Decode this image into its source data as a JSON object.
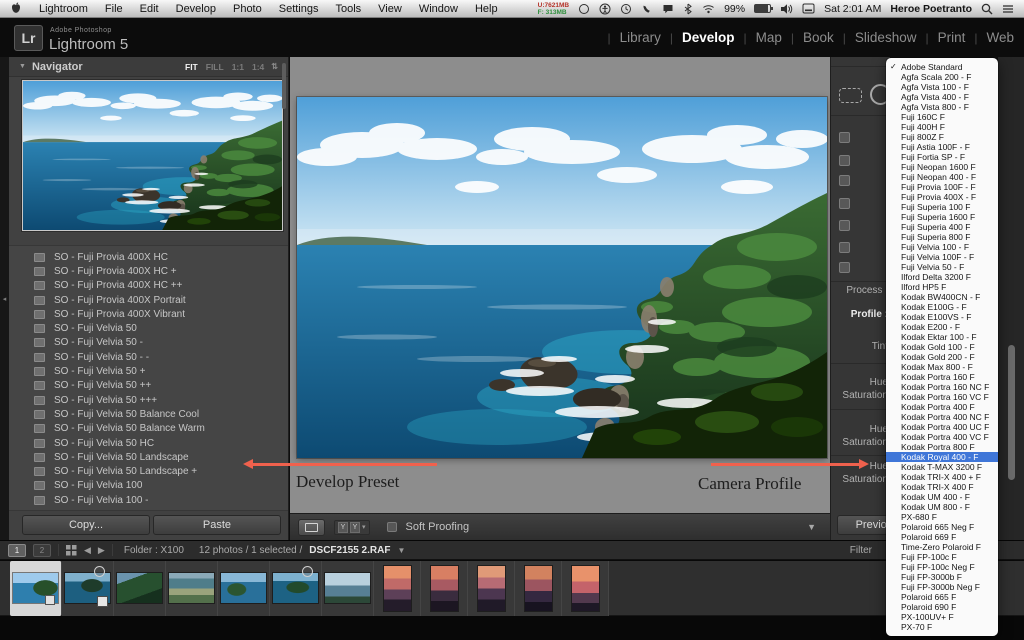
{
  "menubar": {
    "items": [
      "Lightroom",
      "File",
      "Edit",
      "Develop",
      "Photo",
      "Settings",
      "Tools",
      "View",
      "Window",
      "Help"
    ],
    "status": {
      "mem_used": "U:7621MB",
      "mem_free": "F: 313MB",
      "battery_pct": "99%",
      "clock": "Sat 2:01 AM",
      "user": "Heroe Poetranto"
    }
  },
  "titlebar": {
    "logo": "Lr",
    "app_small": "Adobe Photoshop",
    "app_name": "Lightroom 5",
    "modules": [
      {
        "label": "Library"
      },
      {
        "label": "Develop",
        "cls": "active"
      },
      {
        "label": "Map"
      },
      {
        "label": "Book"
      },
      {
        "label": "Slideshow"
      },
      {
        "label": "Print"
      },
      {
        "label": "Web"
      }
    ]
  },
  "navigator": {
    "collapse_glyph": "▼",
    "title": "Navigator",
    "zoom_options": [
      {
        "label": "FIT",
        "cls": "on"
      },
      {
        "label": "FILL"
      },
      {
        "label": "1:1"
      },
      {
        "label": "1:4"
      }
    ],
    "updown_glyph": "⇅"
  },
  "presets": {
    "items": [
      "SO - Fuji Provia 400X HC",
      "SO - Fuji Provia 400X HC +",
      "SO - Fuji Provia 400X HC ++",
      "SO - Fuji Provia 400X Portrait",
      "SO - Fuji Provia 400X Vibrant",
      "SO - Fuji Velvia 50",
      "SO - Fuji Velvia 50 -",
      "SO - Fuji Velvia 50 - -",
      "SO - Fuji Velvia 50 +",
      "SO - Fuji Velvia 50 ++",
      "SO - Fuji Velvia 50 +++",
      "SO - Fuji Velvia 50 Balance Cool",
      "SO - Fuji Velvia 50 Balance Warm",
      "SO - Fuji Velvia 50 HC",
      "SO - Fuji Velvia 50 Landscape",
      "SO - Fuji Velvia 50 Landscape +",
      "SO - Fuji Velvia 100",
      "SO - Fuji Velvia 100 -"
    ]
  },
  "left_buttons": {
    "copy": "Copy...",
    "paste": "Paste"
  },
  "toolbar": {
    "y_label": "Y",
    "soft_proofing": "Soft Proofing",
    "caret": "▼"
  },
  "annotations": {
    "develop_preset": "Develop Preset",
    "camera_profile": "Camera Profile",
    "arrow_color": "#f0614d"
  },
  "right_panel": {
    "process": "Process :",
    "profile": "Profile :",
    "tint": "Tint",
    "hue": "Hue",
    "saturation": "Saturation",
    "previous": "Previous"
  },
  "filmstrip": {
    "win1": "1",
    "win2": "2",
    "back_glyph": "◀",
    "fwd_glyph": "▶",
    "folder": "Folder : X100",
    "status": "12 photos / 1 selected /",
    "filename": "DSCF2155 2.RAF",
    "caret": "▼",
    "filter": "Filter",
    "thumbs": [
      {
        "cls": "wide v1 sel has-adj"
      },
      {
        "cls": "wide v2 has-circle has-crop"
      },
      {
        "cls": "wide v3"
      },
      {
        "cls": "wide v4"
      },
      {
        "cls": "wide v5"
      },
      {
        "cls": "wide v6 has-circle"
      },
      {
        "cls": "wide v7"
      },
      {
        "cls": "tall v8"
      },
      {
        "cls": "tall v9"
      },
      {
        "cls": "tall v10"
      },
      {
        "cls": "tall v11"
      },
      {
        "cls": "tall v12"
      }
    ]
  },
  "profile_menu": {
    "highlight_color": "#3f76d8",
    "items": [
      {
        "check": "✓",
        "label": "Adobe Standard"
      },
      {
        "label": "Agfa Scala 200 - F"
      },
      {
        "label": "Agfa Vista 100 - F"
      },
      {
        "label": "Agfa Vista 400 - F"
      },
      {
        "label": "Agfa Vista 800 - F"
      },
      {
        "label": "Fuji 160C F"
      },
      {
        "label": "Fuji 400H F"
      },
      {
        "label": "Fuji 800Z F"
      },
      {
        "label": "Fuji Astia 100F - F"
      },
      {
        "label": "Fuji Fortia SP - F"
      },
      {
        "label": "Fuji Neopan 1600 F"
      },
      {
        "label": "Fuji Neopan 400 - F"
      },
      {
        "label": "Fuji Provia 100F - F"
      },
      {
        "label": "Fuji Provia 400X - F"
      },
      {
        "label": "Fuji Superia 100 F"
      },
      {
        "label": "Fuji Superia 1600 F"
      },
      {
        "label": "Fuji Superia 400 F"
      },
      {
        "label": "Fuji Superia 800 F"
      },
      {
        "label": "Fuji Velvia 100 - F"
      },
      {
        "label": "Fuji Velvia 100F - F"
      },
      {
        "label": "Fuji Velvia 50 - F"
      },
      {
        "label": "Ilford Delta 3200 F"
      },
      {
        "label": "Ilford HP5 F"
      },
      {
        "label": "Kodak BW400CN - F"
      },
      {
        "label": "Kodak E100G - F"
      },
      {
        "label": "Kodak E100VS - F"
      },
      {
        "label": "Kodak E200 - F"
      },
      {
        "label": "Kodak Ektar 100 - F"
      },
      {
        "label": "Kodak Gold 100 - F"
      },
      {
        "label": "Kodak Gold 200 - F"
      },
      {
        "label": "Kodak Max 800 - F"
      },
      {
        "label": "Kodak Portra 160 F"
      },
      {
        "label": "Kodak Portra 160 NC F"
      },
      {
        "label": "Kodak Portra 160 VC F"
      },
      {
        "label": "Kodak Portra 400 F"
      },
      {
        "label": "Kodak Portra 400 NC F"
      },
      {
        "label": "Kodak Portra 400 UC F"
      },
      {
        "label": "Kodak Portra 400 VC F"
      },
      {
        "label": "Kodak Portra 800 F"
      },
      {
        "cls": "selected",
        "label": "Kodak Royal 400 - F"
      },
      {
        "label": "Kodak T-MAX 3200 F"
      },
      {
        "label": "Kodak TRI-X 400 + F"
      },
      {
        "label": "Kodak TRI-X 400 F"
      },
      {
        "label": "Kodak UM 400 - F"
      },
      {
        "label": "Kodak UM 800 - F"
      },
      {
        "label": "PX-680 F"
      },
      {
        "label": "Polaroid 665 Neg F"
      },
      {
        "label": "Polaroid 669 F"
      },
      {
        "label": "Time-Zero Polaroid F"
      },
      {
        "label": "Fuji FP-100c F"
      },
      {
        "label": "Fuji FP-100c Neg F"
      },
      {
        "label": "Fuji FP-3000b F"
      },
      {
        "label": "Fuji FP-3000b Neg F"
      },
      {
        "label": "Polaroid 665 F"
      },
      {
        "label": "Polaroid 690 F"
      },
      {
        "label": "PX-100UV+ F"
      },
      {
        "label": "PX-70 F"
      }
    ]
  }
}
